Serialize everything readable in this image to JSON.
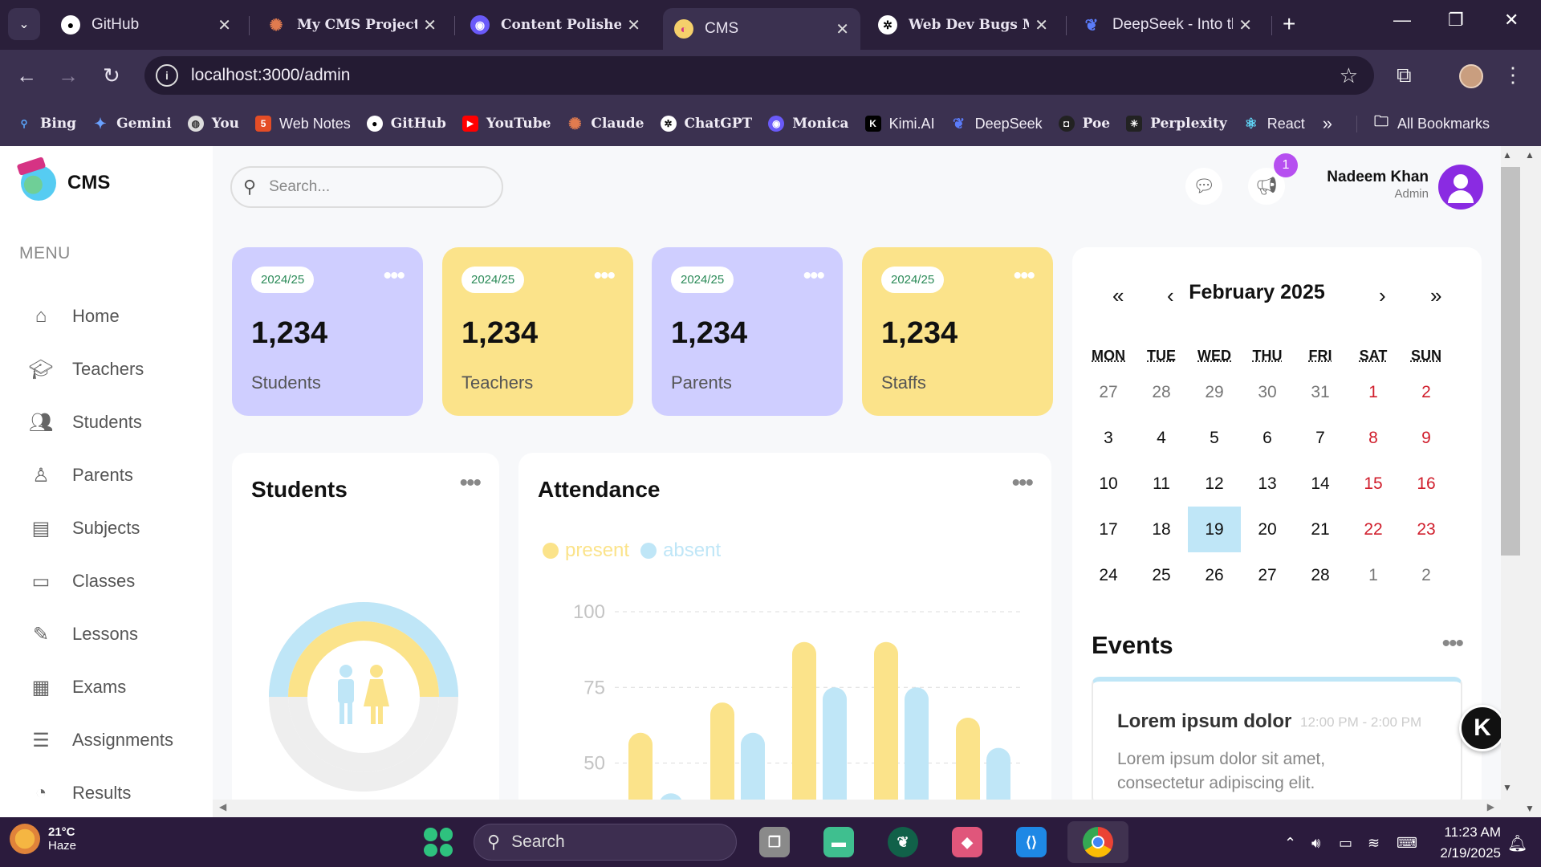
{
  "browser": {
    "tabs": [
      {
        "title": "GitHub",
        "bold": false
      },
      {
        "title": "My CMS Project -",
        "bold": true
      },
      {
        "title": "Content Polisher",
        "bold": true
      },
      {
        "title": "CMS",
        "bold": false
      },
      {
        "title": "Web Dev Bugs Mc",
        "bold": true
      },
      {
        "title": "DeepSeek - Into th",
        "bold": false
      }
    ],
    "url": "localhost:3000/admin",
    "bookmarks": [
      "Bing",
      "Gemini",
      "You",
      "Web Notes",
      "GitHub",
      "YouTube",
      "Claude",
      "ChatGPT",
      "Monica",
      "Kimi.AI",
      "DeepSeek",
      "Poe",
      "Perplexity",
      "React"
    ],
    "all_bookmarks": "All Bookmarks"
  },
  "sidebar": {
    "logo_text": "CMS",
    "menu_heading": "MENU",
    "items": [
      {
        "label": "Home",
        "icon": "home-icon"
      },
      {
        "label": "Teachers",
        "icon": "teacher-icon"
      },
      {
        "label": "Students",
        "icon": "students-icon"
      },
      {
        "label": "Parents",
        "icon": "parents-icon"
      },
      {
        "label": "Subjects",
        "icon": "subjects-icon"
      },
      {
        "label": "Classes",
        "icon": "classes-icon"
      },
      {
        "label": "Lessons",
        "icon": "lessons-icon"
      },
      {
        "label": "Exams",
        "icon": "exams-icon"
      },
      {
        "label": "Assignments",
        "icon": "assignments-icon"
      },
      {
        "label": "Results",
        "icon": "results-icon"
      }
    ]
  },
  "header": {
    "search_placeholder": "Search...",
    "notification_count": "1",
    "user_name": "Nadeem Khan",
    "user_role": "Admin"
  },
  "cards": [
    {
      "year": "2024/25",
      "value": "1,234",
      "label": "Students",
      "color": "#cfceff"
    },
    {
      "year": "2024/25",
      "value": "1,234",
      "label": "Teachers",
      "color": "#fbe38a"
    },
    {
      "year": "2024/25",
      "value": "1,234",
      "label": "Parents",
      "color": "#cfceff"
    },
    {
      "year": "2024/25",
      "value": "1,234",
      "label": "Staffs",
      "color": "#fbe38a"
    }
  ],
  "students_panel": {
    "title": "Students"
  },
  "attendance_panel": {
    "title": "Attendance",
    "legend_present": "present",
    "legend_absent": "absent"
  },
  "chart_data": {
    "type": "bar",
    "yticks": [
      50,
      75,
      100
    ],
    "ylim": [
      0,
      100
    ],
    "series": [
      {
        "name": "present",
        "color": "#fbe38a",
        "values": [
          60,
          70,
          90,
          90,
          65
        ]
      },
      {
        "name": "absent",
        "color": "#bfe6f7",
        "values": [
          40,
          60,
          75,
          75,
          55
        ]
      }
    ]
  },
  "calendar": {
    "month_title": "February 2025",
    "nav": {
      "prev_year": "«",
      "prev_month": "‹",
      "next_month": "›",
      "next_year": "»"
    },
    "weekdays": [
      "MON",
      "TUE",
      "WED",
      "THU",
      "FRI",
      "SAT",
      "SUN"
    ],
    "weeks": [
      [
        "27",
        "28",
        "29",
        "30",
        "31",
        "1",
        "2"
      ],
      [
        "3",
        "4",
        "5",
        "6",
        "7",
        "8",
        "9"
      ],
      [
        "10",
        "11",
        "12",
        "13",
        "14",
        "15",
        "16"
      ],
      [
        "17",
        "18",
        "19",
        "20",
        "21",
        "22",
        "23"
      ],
      [
        "24",
        "25",
        "26",
        "27",
        "28",
        "1",
        "2"
      ]
    ],
    "today": "19"
  },
  "events": {
    "title": "Events",
    "items": [
      {
        "title": "Lorem ipsum dolor",
        "time": "12:00 PM - 2:00 PM",
        "description": "Lorem ipsum dolor sit amet, consectetur adipiscing elit."
      }
    ]
  },
  "taskbar": {
    "temperature": "21°C",
    "weather": "Haze",
    "search_label": "Search",
    "time": "11:23 AM",
    "date": "2/19/2025"
  }
}
